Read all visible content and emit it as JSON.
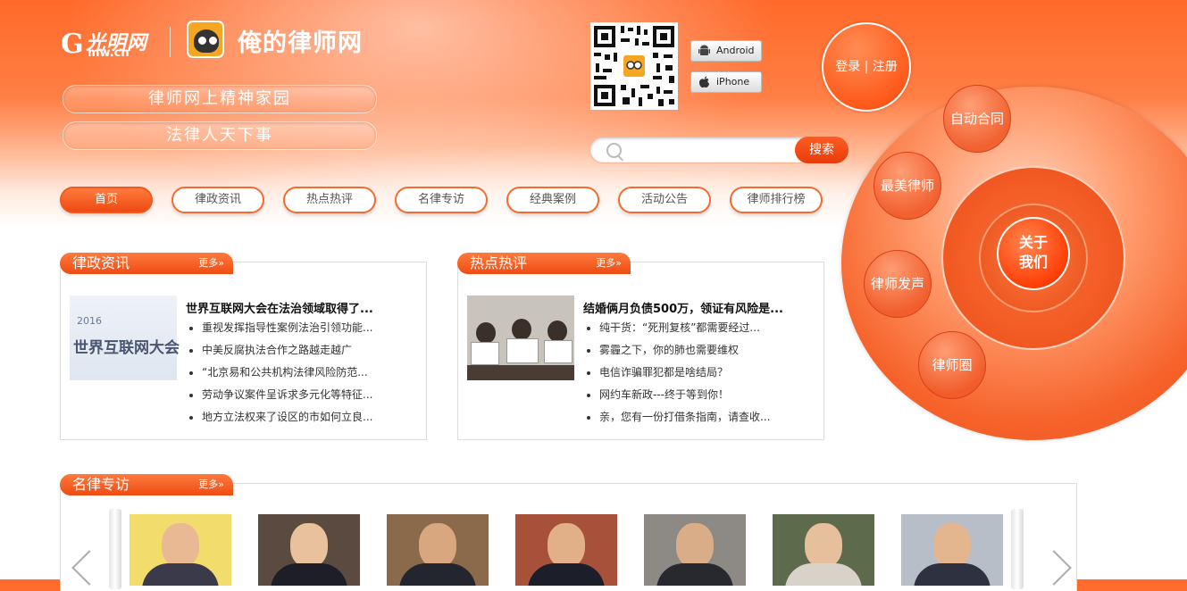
{
  "header": {
    "gmw_logo_g": "G",
    "gmw_logo_cn": "光明网",
    "gmw_logo_domain": "mw.cn",
    "site_name": "俺的律师网",
    "slogans": [
      "律师网上精神家园",
      "法律人天下事"
    ]
  },
  "apps": {
    "android_label": "Android",
    "iphone_label": "iPhone"
  },
  "search": {
    "placeholder": "",
    "button_label": "搜索"
  },
  "auth": {
    "login_register": "登录 | 注册"
  },
  "nav": {
    "items": [
      "首页",
      "律政资讯",
      "热点热评",
      "名律专访",
      "经典案例",
      "活动公告",
      "律师排行榜"
    ]
  },
  "circle_menu": {
    "contract": "自动合同",
    "best_lawyer": "最美律师",
    "lawyer_voice": "律师发声",
    "lawyer_circle": "律师圈",
    "about_line1": "关于",
    "about_line2": "我们"
  },
  "panels": {
    "legal_news": {
      "title": "律政资讯",
      "more": "更多»",
      "thumb_text": "世界互联网大会",
      "thumb_year": "2016",
      "headline": "世界互联网大会在法治领域取得了...",
      "items": [
        "重视发挥指导性案例法治引领功能...",
        "中美反腐执法合作之路越走越广",
        "“北京易和公共机构法律风险防范...",
        "劳动争议案件呈诉求多元化等特征...",
        "地方立法权来了设区的市如何立良..."
      ]
    },
    "hot_comments": {
      "title": "热点热评",
      "more": "更多»",
      "headline": "结婚俩月负债500万，领证有风险是...",
      "items": [
        "纯干货：“死刑复核”都需要经过...",
        "雾霾之下，你的肺也需要维权",
        "电信诈骗罪犯都是啥结局？",
        "网约车新政---终于等到你！",
        "亲，您有一份打借条指南，请查收..."
      ]
    },
    "interviews": {
      "title": "名律专访",
      "more": "更多»"
    }
  },
  "colors": {
    "brand_orange": "#f46b2d",
    "brand_red": "#ee4a12"
  }
}
